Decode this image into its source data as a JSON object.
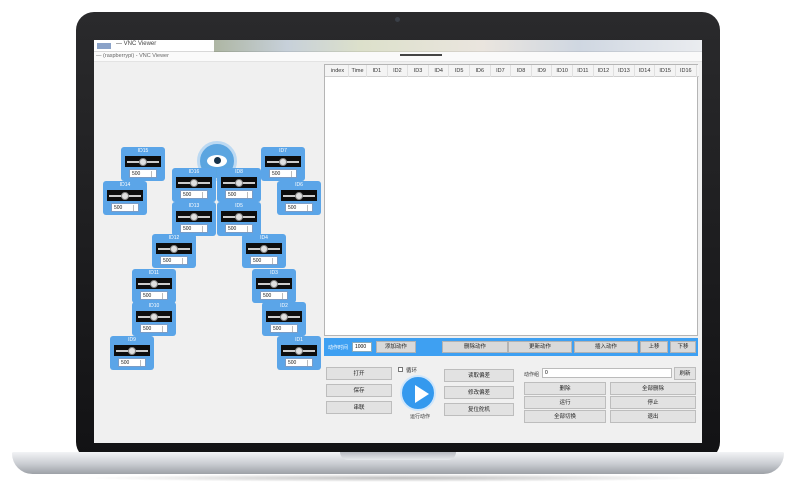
{
  "window": {
    "title": "— VNC Viewer",
    "subtitle": "— (raspberrypi) - VNC Viewer"
  },
  "table": {
    "columns": [
      "index",
      "Time",
      "ID1",
      "ID2",
      "ID3",
      "ID4",
      "ID5",
      "ID6",
      "ID7",
      "ID8",
      "ID9",
      "ID10",
      "ID11",
      "ID12",
      "ID13",
      "ID14",
      "ID15",
      "ID16"
    ]
  },
  "servos": [
    {
      "id": "ID15",
      "value": "500"
    },
    {
      "id": "ID7",
      "value": "500"
    },
    {
      "id": "ID14",
      "value": "500"
    },
    {
      "id": "ID16",
      "value": "500"
    },
    {
      "id": "ID8",
      "value": "500"
    },
    {
      "id": "ID6",
      "value": "500"
    },
    {
      "id": "ID13",
      "value": "500"
    },
    {
      "id": "ID5",
      "value": "500"
    },
    {
      "id": "ID12",
      "value": "500"
    },
    {
      "id": "ID4",
      "value": "500"
    },
    {
      "id": "ID11",
      "value": "500"
    },
    {
      "id": "ID3",
      "value": "500"
    },
    {
      "id": "ID10",
      "value": "500"
    },
    {
      "id": "ID2",
      "value": "500"
    },
    {
      "id": "ID9",
      "value": "500"
    },
    {
      "id": "ID1",
      "value": "500"
    }
  ],
  "toolbar": {
    "time_label": "动作时间",
    "time_value": "1000",
    "add": "添加动作",
    "delete": "删除动作",
    "update": "更新动作",
    "insert": "插入动作",
    "move_up": "上移",
    "move_down": "下移"
  },
  "bottom": {
    "open": "打开",
    "save": "保存",
    "connect": "串联",
    "loop": "循环",
    "run_caption": "运行动作",
    "read_deviation": "读取偏差",
    "modify_deviation": "修改偏差",
    "reset_servo": "复位舵机",
    "group_label": "动作组",
    "group_value": "0",
    "refresh": "刷新",
    "delete": "删除",
    "delete_all": "全部删除",
    "run": "运行",
    "stop": "停止",
    "switch_all": "全部切换",
    "exit": "退出"
  }
}
